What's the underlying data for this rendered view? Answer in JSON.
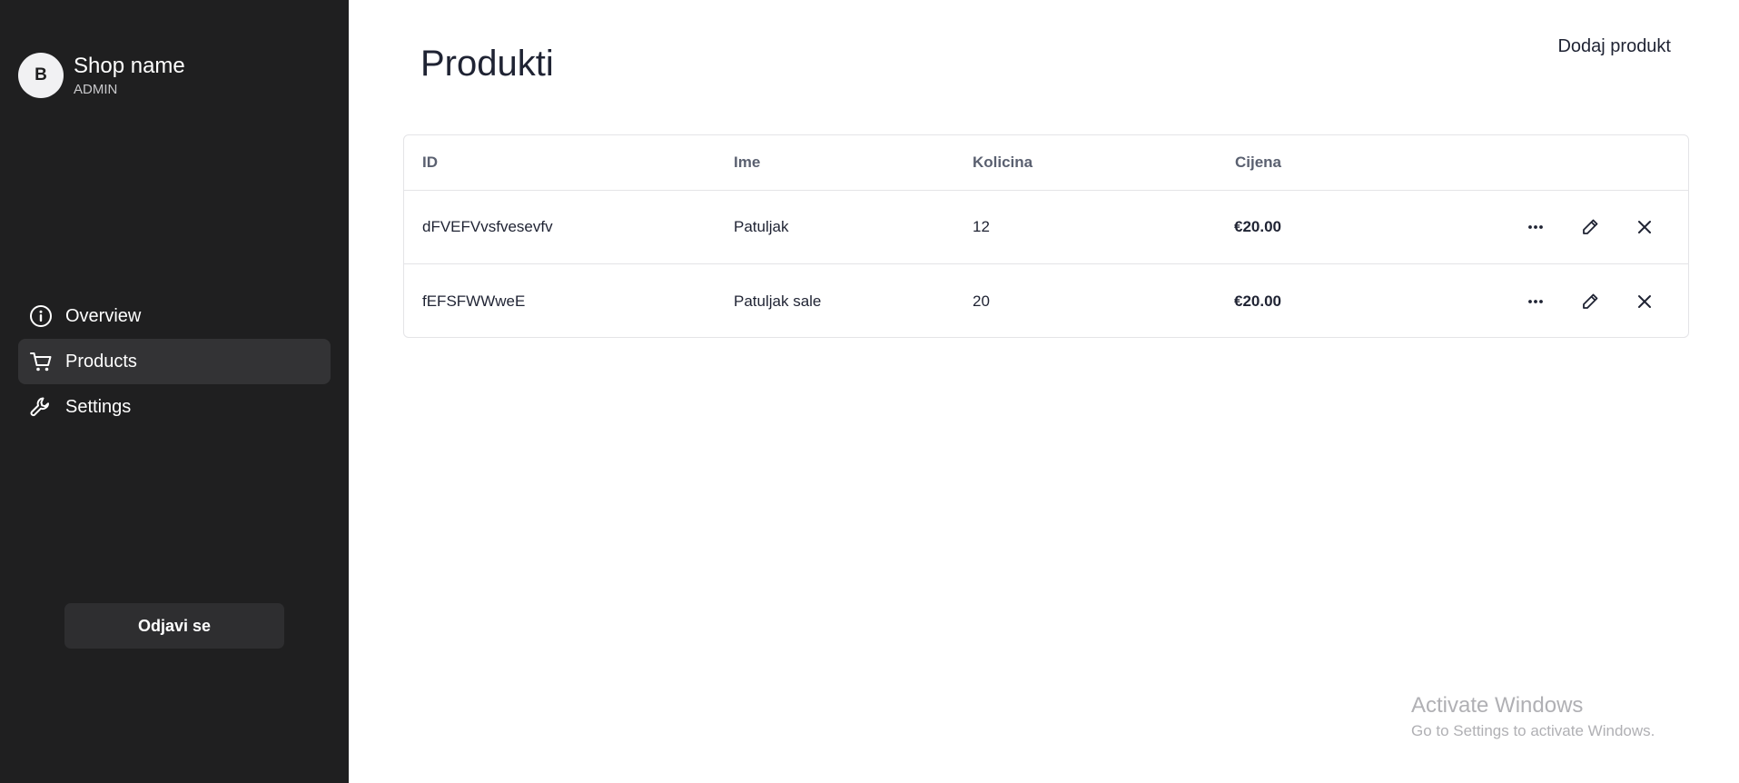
{
  "sidebar": {
    "avatar_initial": "B",
    "shop_name": "Shop name",
    "role": "ADMIN",
    "nav": [
      {
        "label": "Overview",
        "icon": "info-circle-icon",
        "active": false
      },
      {
        "label": "Products",
        "icon": "cart-icon",
        "active": true
      },
      {
        "label": "Settings",
        "icon": "wrench-icon",
        "active": false
      }
    ],
    "logout_label": "Odjavi se"
  },
  "main": {
    "title": "Produkti",
    "add_button": "Dodaj produkt",
    "table": {
      "headers": {
        "id": "ID",
        "name": "Ime",
        "qty": "Kolicina",
        "price": "Cijena"
      },
      "rows": [
        {
          "id": "dFVEFVvsfvesevfv",
          "name": "Patuljak",
          "qty": "12",
          "price": "€20.00"
        },
        {
          "id": "fEFSFWWweE",
          "name": "Patuljak sale",
          "qty": "20",
          "price": "€20.00"
        }
      ],
      "row_actions": [
        "more-icon",
        "edit-pencil-icon",
        "delete-x-icon"
      ]
    }
  },
  "watermark": {
    "title": "Activate Windows",
    "subtitle": "Go to Settings to activate Windows."
  },
  "colors": {
    "sidebar_bg": "#1f1f20",
    "active_nav_bg": "#333335",
    "text_dark": "#1f2333",
    "border": "#e4e4e7"
  }
}
